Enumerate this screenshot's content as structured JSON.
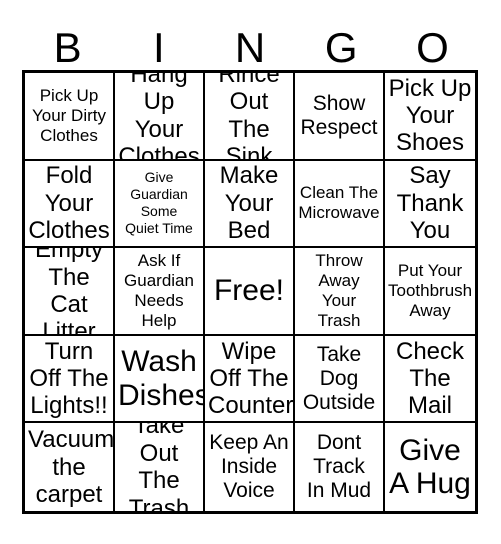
{
  "card": {
    "header_letters": [
      "B",
      "I",
      "N",
      "G",
      "O"
    ],
    "colors": {
      "background": "#ffffff",
      "text": "#000000",
      "border": "#000000"
    },
    "grid_size": "5x5",
    "rows": [
      {
        "cells": [
          {
            "text": "Pick Up\nYour Dirty\nClothes",
            "size": "sm",
            "free": false
          },
          {
            "text": "Hang\nUp Your\nClothes",
            "size": "lg",
            "free": false
          },
          {
            "text": "Rince\nOut The\nSink",
            "size": "lg",
            "free": false
          },
          {
            "text": "Show\nRespect",
            "size": "md",
            "free": false
          },
          {
            "text": "Pick Up\nYour\nShoes",
            "size": "lg",
            "free": false
          }
        ]
      },
      {
        "cells": [
          {
            "text": "Fold\nYour\nClothes",
            "size": "lg",
            "free": false
          },
          {
            "text": "Give\nGuardian\nSome\nQuiet Time",
            "size": "xs",
            "free": false
          },
          {
            "text": "Make\nYour\nBed",
            "size": "lg",
            "free": false
          },
          {
            "text": "Clean The\nMicrowave",
            "size": "sm",
            "free": false
          },
          {
            "text": "Say\nThank\nYou",
            "size": "lg",
            "free": false
          }
        ]
      },
      {
        "cells": [
          {
            "text": "Empty\nThe Cat\nLitter",
            "size": "lg",
            "free": false
          },
          {
            "text": "Ask If\nGuardian\nNeeds\nHelp",
            "size": "sm",
            "free": false
          },
          {
            "text": "Free!",
            "size": "xl",
            "free": true
          },
          {
            "text": "Throw\nAway\nYour\nTrash",
            "size": "sm",
            "free": false
          },
          {
            "text": "Put Your\nToothbrush\nAway",
            "size": "sm",
            "free": false
          }
        ]
      },
      {
        "cells": [
          {
            "text": "Turn\nOff The\nLights!!",
            "size": "lg",
            "free": false
          },
          {
            "text": "Wash\nDishes",
            "size": "xl",
            "free": false
          },
          {
            "text": "Wipe\nOff The\nCounter",
            "size": "lg",
            "free": false
          },
          {
            "text": "Take\nDog\nOutside",
            "size": "md",
            "free": false
          },
          {
            "text": "Check\nThe\nMail",
            "size": "lg",
            "free": false
          }
        ]
      },
      {
        "cells": [
          {
            "text": "Vacuum\nthe\ncarpet",
            "size": "lg",
            "free": false
          },
          {
            "text": "Take\nOut The\nTrash",
            "size": "lg",
            "free": false
          },
          {
            "text": "Keep An\nInside\nVoice",
            "size": "md",
            "free": false
          },
          {
            "text": "Dont\nTrack\nIn Mud",
            "size": "md",
            "free": false
          },
          {
            "text": "Give\nA Hug",
            "size": "xl",
            "free": false
          }
        ]
      }
    ]
  }
}
